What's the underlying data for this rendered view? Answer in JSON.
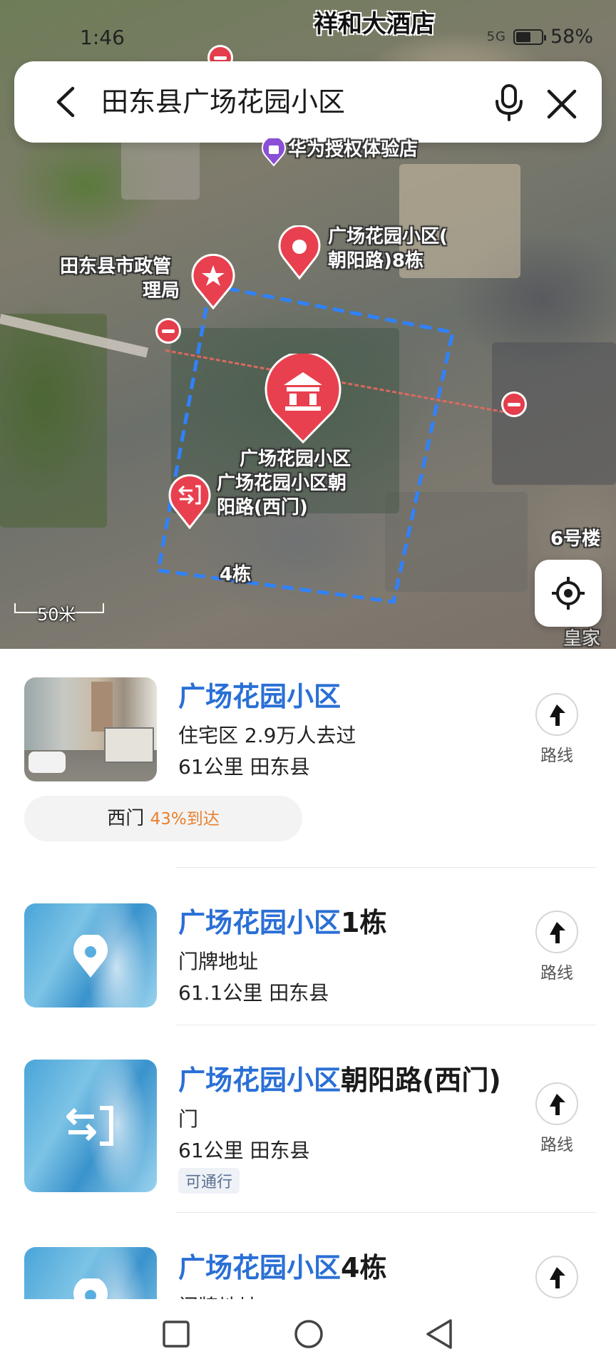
{
  "status": {
    "time": "1:46",
    "signal": "5G",
    "battery": "58%",
    "battery_level": 0.58
  },
  "search": {
    "query": "田东县广场花园小区"
  },
  "map": {
    "labels": {
      "hotel": "祥和大酒店",
      "huawei": "华为授权体验店",
      "bldg8_line1": "广场花园小区(",
      "bldg8_line2": "朝阳路)8栋",
      "bureau_line1": "田东县市政管",
      "bureau_line2": "理局",
      "main_poi": "广场花园小区",
      "gate_line1": "广场花园小区朝",
      "gate_line2": "阳路(西门)",
      "bldg4": "4栋",
      "bldg6": "6号楼",
      "huangjia": "皇家"
    },
    "scale": "50米"
  },
  "results": [
    {
      "title_highlight": "广场花园小区",
      "title_rest": "",
      "line1": "住宅区  2.9万人去过",
      "line2": "61公里  田东县",
      "route_label": "路线",
      "gate_name": "西门",
      "gate_percent": "43%到达"
    },
    {
      "title_highlight": "广场花园小区",
      "title_rest": "1栋",
      "line1": "门牌地址",
      "line2": "61.1公里  田东县",
      "route_label": "路线"
    },
    {
      "title_highlight": "广场花园小区",
      "title_rest": "朝阳路(西门)",
      "line1": "门",
      "line2": "61公里  田东县",
      "tag": "可通行",
      "route_label": "路线"
    },
    {
      "title_highlight": "广场花园小区",
      "title_rest": "4栋",
      "line1": "门牌地址"
    }
  ]
}
